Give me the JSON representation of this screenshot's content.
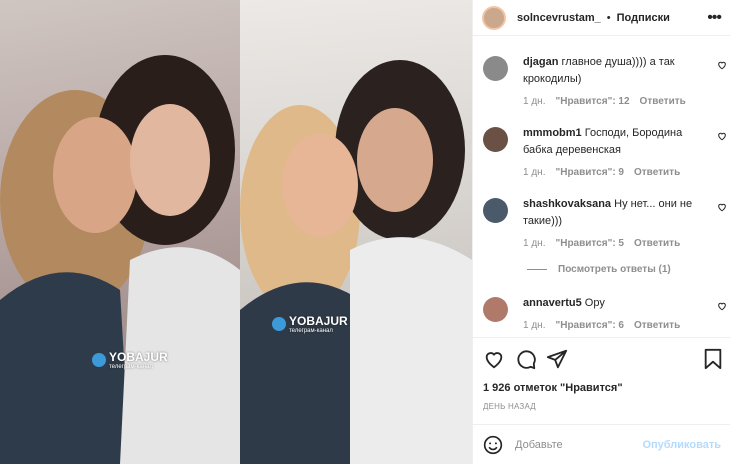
{
  "post": {
    "watermark": {
      "name": "YOBAJUR",
      "sub": "телеграм-канал"
    }
  },
  "header": {
    "username": "solncevrustam_",
    "separator": "•",
    "follow_label": "Подписки",
    "more_glyph": "•••"
  },
  "comments": [
    {
      "user": "djagan",
      "text": "главное душа)))) а так крокодилы)",
      "time": "1 дн.",
      "likes": "\"Нравится\": 12",
      "reply": "Ответить"
    },
    {
      "user": "mmmobm1",
      "text": "Господи, Бородина бабка деревенская",
      "time": "1 дн.",
      "likes": "\"Нравится\": 9",
      "reply": "Ответить"
    },
    {
      "user": "shashkovaksana",
      "text": "Ну нет... они не такие)))",
      "time": "1 дн.",
      "likes": "\"Нравится\": 5",
      "reply": "Ответить"
    },
    {
      "user": "annavertu5",
      "text": "Ору",
      "time": "1 дн.",
      "likes": "\"Нравится\": 6",
      "reply": "Ответить"
    }
  ],
  "view_replies": "Посмотреть ответы (1)",
  "likes_count": "1 926 отметок \"Нравится\"",
  "date_label": "ДЕНЬ НАЗАД",
  "add_comment": {
    "placeholder": "Добавьте комментарий...",
    "placeholder_short": "Добавьте",
    "publish": "Опубликовать"
  },
  "icons": [
    "heart-icon",
    "comment-icon",
    "share-icon",
    "bookmark-icon",
    "emoji-icon"
  ],
  "colors": {
    "link_disabled": "#b3dbff",
    "muted": "#8e8e8e",
    "text": "#262626"
  }
}
